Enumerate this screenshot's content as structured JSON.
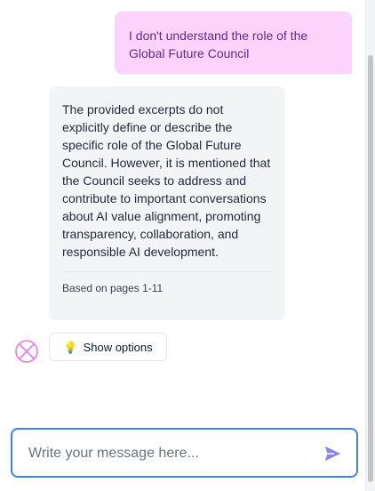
{
  "messages": {
    "user": {
      "text": "I don't understand the role of the Global Future Council"
    },
    "bot": {
      "text": "The provided excerpts do not explicitly define or describe the specific role of the Global Future Council. However, it is mentioned that the Council seeks to address and contribute to important conversations about AI value alignment, promoting transparency, collaboration, and responsible AI development.",
      "source": "Based on pages 1-11"
    }
  },
  "options": {
    "label": "Show options",
    "icon": "lightbulb-icon"
  },
  "composer": {
    "placeholder": "Write your message here...",
    "value": ""
  },
  "avatar": {
    "icon": "crossed-circle-icon"
  },
  "colors": {
    "user_bubble_bg": "#fbd3fb",
    "user_text": "#5b2d8e",
    "bot_bubble_bg": "#f3f4f6",
    "accent_blue": "#3b82f6",
    "send_icon": "#8b85f0",
    "avatar_pink": "#e879f9"
  }
}
